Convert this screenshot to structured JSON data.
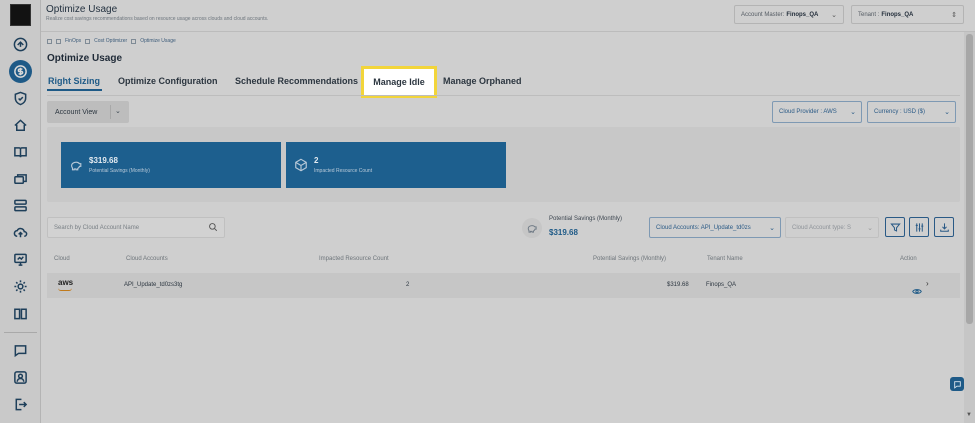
{
  "header": {
    "title": "Optimize Usage",
    "subtitle": "Realize cost savings recommendations based on resource usage across clouds and cloud accounts.",
    "account_master_label": "Account Master:",
    "account_master_value": "Finops_QA",
    "tenant_label": "Tenant :",
    "tenant_value": "Finops_QA"
  },
  "breadcrumb": [
    "FinOps",
    "Cost Optimizer",
    "Optimize Usage"
  ],
  "page_title": "Optimize Usage",
  "tabs": [
    {
      "label": "Right Sizing",
      "active": true
    },
    {
      "label": "Optimize Configuration",
      "active": false
    },
    {
      "label": "Schedule Recommendations",
      "active": false
    },
    {
      "label": "Manage Idle",
      "active": false,
      "highlighted": true
    },
    {
      "label": "Manage Orphaned",
      "active": false
    }
  ],
  "account_view": "Account View",
  "cloud_provider": "Cloud Provider : AWS",
  "currency": "Currency : USD ($)",
  "cards": [
    {
      "value": "$319.68",
      "label": "Potential Savings (Monthly)",
      "icon": "piggy-bank-icon"
    },
    {
      "value": "2",
      "label": "Impacted Resource Count",
      "icon": "cube-icon"
    }
  ],
  "search": {
    "placeholder": "Search by Cloud Account Name"
  },
  "potential_savings": {
    "label": "Potential Savings (Monthly)",
    "value": "$319.68"
  },
  "cloud_accounts_filter": "Cloud Accounts: API_Update_td0zs",
  "cloud_account_type_filter": "Cloud Account type: S",
  "table": {
    "columns": [
      "Cloud",
      "Cloud Accounts",
      "Impacted Resource Count",
      "Potential Savings (Monthly)",
      "Tenant Name",
      "Action"
    ],
    "rows": [
      {
        "cloud": "aws",
        "account": "API_Update_td0zs3tg",
        "count": "2",
        "savings": "$319.68",
        "tenant": "Finops_QA"
      }
    ]
  },
  "colors": {
    "accent": "#1e5a87",
    "highlight_border": "#f2d53a",
    "card_bg": "#1d5f8e"
  }
}
